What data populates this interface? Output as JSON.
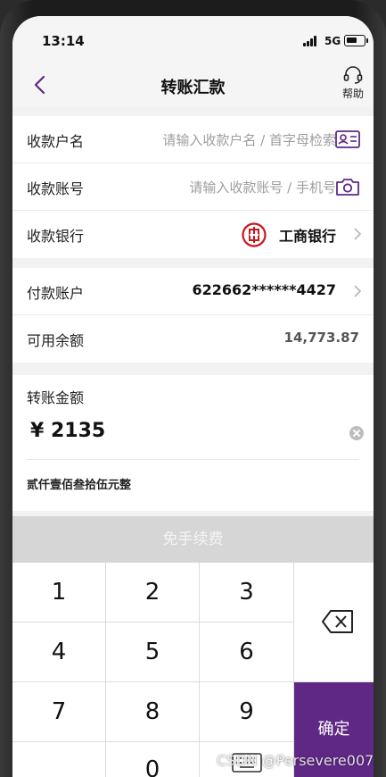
{
  "status_bar": {
    "time": "13:14",
    "network": "5G"
  },
  "nav": {
    "title": "转账汇款",
    "help_label": "帮助"
  },
  "payee": {
    "name_label": "收款户名",
    "name_placeholder": "请输入收款户名 / 首字母检索",
    "account_label": "收款账号",
    "account_placeholder": "请输入收款账号 / 手机号",
    "bank_label": "收款银行",
    "bank_value": "工商银行"
  },
  "payer": {
    "account_label": "付款账户",
    "account_value": "622662******4427",
    "balance_label": "可用余额",
    "balance_value": "14,773.87"
  },
  "amount": {
    "label": "转账金额",
    "value": "¥ 2135",
    "in_words": "贰仟壹佰叁拾伍元整"
  },
  "fee_button": {
    "label": "免手续费"
  },
  "keypad": {
    "keys": [
      "1",
      "2",
      "3",
      "4",
      "5",
      "6",
      "7",
      "8",
      "9",
      "0"
    ],
    "confirm_label": "确定"
  },
  "watermark": "CSDN @Persevere007",
  "colors": {
    "accent": "#5f2885",
    "bank_logo": "#c8161d"
  }
}
